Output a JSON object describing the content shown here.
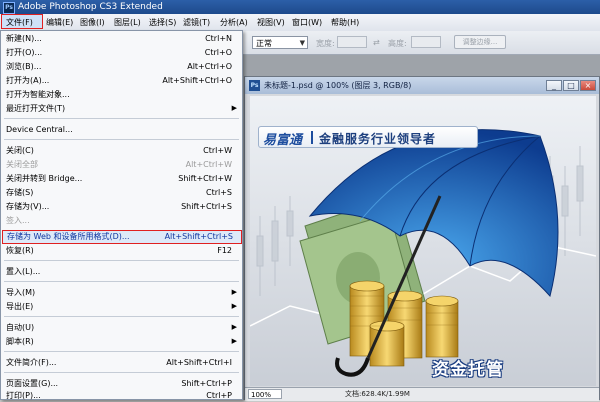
{
  "window": {
    "title": "Adobe Photoshop CS3 Extended",
    "logo_text": "Ps"
  },
  "menubar": {
    "items": [
      "文件(F)",
      "编辑(E)",
      "图像(I)",
      "图层(L)",
      "选择(S)",
      "滤镜(T)",
      "分析(A)",
      "视图(V)",
      "窗口(W)",
      "帮助(H)"
    ]
  },
  "options": {
    "mode_value": "正常",
    "width_label": "宽度:",
    "height_label": "高度:",
    "refine_label": "调整边缘..."
  },
  "file_menu": {
    "items": [
      {
        "label": "新建(N)...",
        "shortcut": "Ctrl+N"
      },
      {
        "label": "打开(O)...",
        "shortcut": "Ctrl+O"
      },
      {
        "label": "浏览(B)...",
        "shortcut": "Alt+Ctrl+O"
      },
      {
        "label": "打开为(A)...",
        "shortcut": "Alt+Shift+Ctrl+O"
      },
      {
        "label": "打开为智能对象...",
        "shortcut": ""
      },
      {
        "label": "最近打开文件(T)",
        "shortcut": ""
      },
      {
        "label": "Device Central...",
        "shortcut": ""
      },
      {
        "label": "关闭(C)",
        "shortcut": "Ctrl+W"
      },
      {
        "label": "关闭全部",
        "shortcut": "Alt+Ctrl+W"
      },
      {
        "label": "关闭并转到 Bridge...",
        "shortcut": "Shift+Ctrl+W"
      },
      {
        "label": "存储(S)",
        "shortcut": "Ctrl+S"
      },
      {
        "label": "存储为(V)...",
        "shortcut": "Shift+Ctrl+S"
      },
      {
        "label": "签入...",
        "shortcut": ""
      },
      {
        "label": "存储为 Web 和设备所用格式(D)...",
        "shortcut": "Alt+Shift+Ctrl+S"
      },
      {
        "label": "恢复(R)",
        "shortcut": "F12"
      },
      {
        "label": "置入(L)...",
        "shortcut": ""
      },
      {
        "label": "导入(M)",
        "shortcut": ""
      },
      {
        "label": "导出(E)",
        "shortcut": ""
      },
      {
        "label": "自动(U)",
        "shortcut": ""
      },
      {
        "label": "脚本(R)",
        "shortcut": ""
      },
      {
        "label": "文件简介(F)...",
        "shortcut": "Alt+Shift+Ctrl+I"
      },
      {
        "label": "页面设置(G)...",
        "shortcut": "Shift+Ctrl+P"
      },
      {
        "label": "打印(P)...",
        "shortcut": "Ctrl+P"
      }
    ]
  },
  "document": {
    "title": "未标题-1.psd @ 100% (图层 3, RGB/8)",
    "logo_mark": "易富通",
    "slogan": "金融服务行业领导者",
    "caption": "资金托管",
    "zoom": "100%",
    "doc_size": "文档:628.4K/1.99M"
  },
  "colors": {
    "highlight_border": "#e02020",
    "accent": "#1d4d9e"
  }
}
